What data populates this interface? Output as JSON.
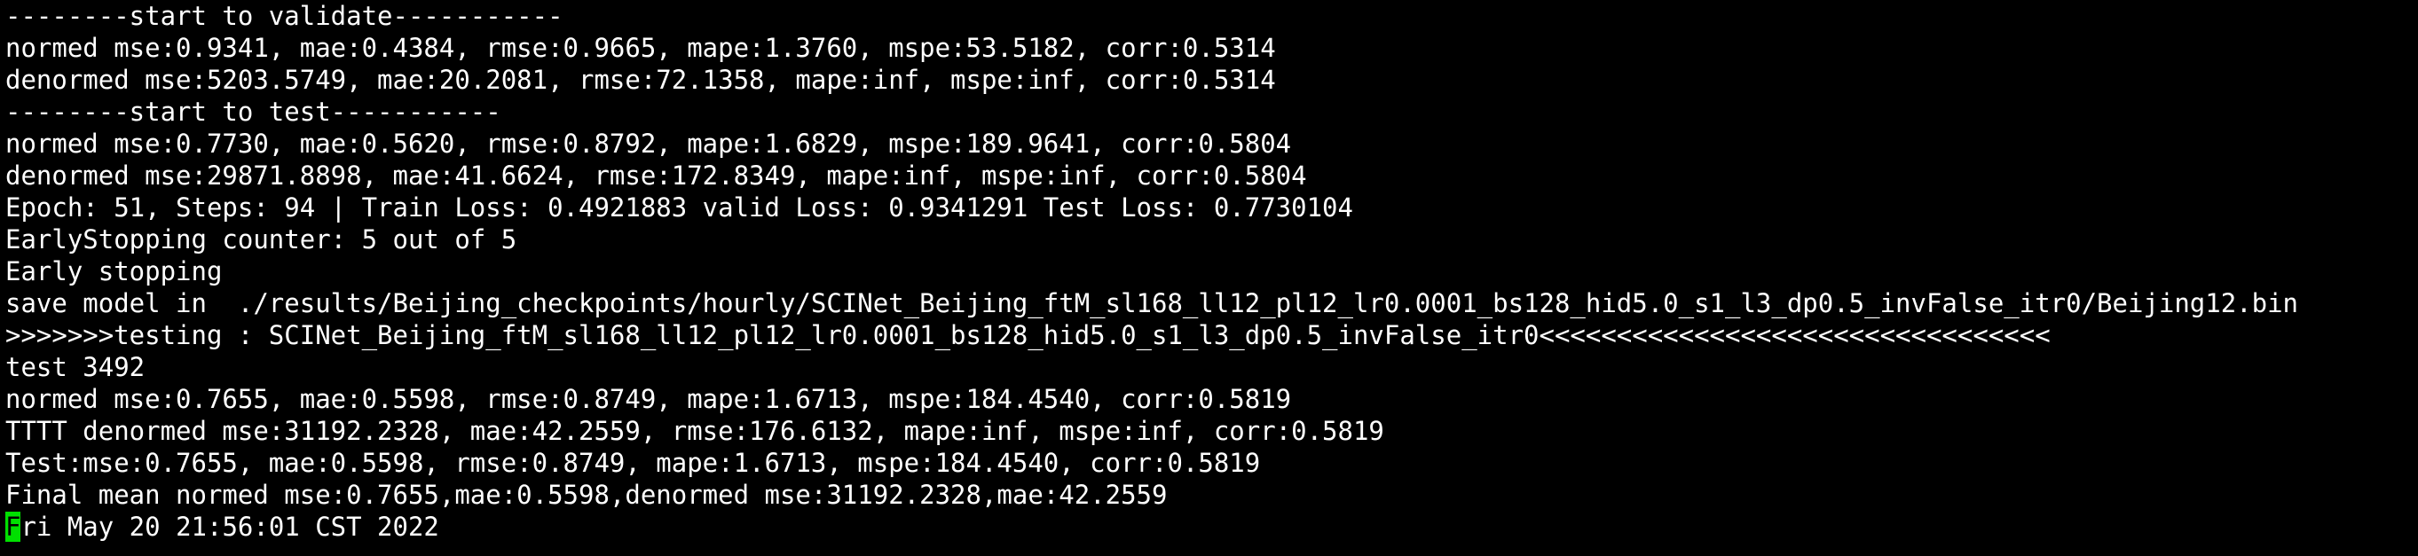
{
  "terminal": {
    "lines": [
      "--------start to validate-----------",
      "normed mse:0.9341, mae:0.4384, rmse:0.9665, mape:1.3760, mspe:53.5182, corr:0.5314",
      "denormed mse:5203.5749, mae:20.2081, rmse:72.1358, mape:inf, mspe:inf, corr:0.5314",
      "--------start to test-----------",
      "normed mse:0.7730, mae:0.5620, rmse:0.8792, mape:1.6829, mspe:189.9641, corr:0.5804",
      "denormed mse:29871.8898, mae:41.6624, rmse:172.8349, mape:inf, mspe:inf, corr:0.5804",
      "Epoch: 51, Steps: 94 | Train Loss: 0.4921883 valid Loss: 0.9341291 Test Loss: 0.7730104",
      "EarlyStopping counter: 5 out of 5",
      "Early stopping",
      "save model in  ./results/Beijing_checkpoints/hourly/SCINet_Beijing_ftM_sl168_ll12_pl12_lr0.0001_bs128_hid5.0_s1_l3_dp0.5_invFalse_itr0/Beijing12.bin",
      ">>>>>>>testing : SCINet_Beijing_ftM_sl168_ll12_pl12_lr0.0001_bs128_hid5.0_s1_l3_dp0.5_invFalse_itr0<<<<<<<<<<<<<<<<<<<<<<<<<<<<<<<<<",
      "test 3492",
      "normed mse:0.7655, mae:0.5598, rmse:0.8749, mape:1.6713, mspe:184.4540, corr:0.5819",
      "TTTT denormed mse:31192.2328, mae:42.2559, rmse:176.6132, mape:inf, mspe:inf, corr:0.5819",
      "Test:mse:0.7655, mae:0.5598, rmse:0.8749, mape:1.6713, mspe:184.4540, corr:0.5819",
      "Final mean normed mse:0.7655,mae:0.5598,denormed mse:31192.2328,mae:42.2559"
    ],
    "prompt_cursor_char": "F",
    "prompt_rest": "ri May 20 21:56:01 CST 2022",
    "colors": {
      "background": "#000000",
      "foreground": "#ffffff",
      "cursor": "#00e000"
    }
  }
}
